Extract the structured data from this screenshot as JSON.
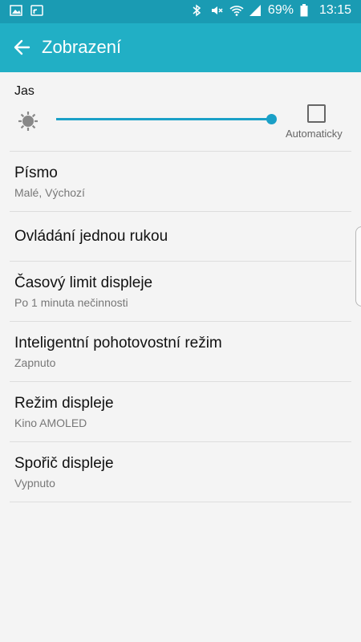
{
  "status_bar": {
    "battery_percent": "69%",
    "time": "13:15",
    "left_icons": [
      "gallery-icon",
      "cast-icon"
    ],
    "right_icons": [
      "bluetooth-icon",
      "mute-icon",
      "wifi-icon",
      "signal-icon",
      "battery-icon"
    ]
  },
  "appbar": {
    "title": "Zobrazení",
    "back_icon": "arrow-back-icon",
    "bg_color": "#21afc5"
  },
  "brightness": {
    "label": "Jas",
    "level": 1.0,
    "auto_label": "Automaticky",
    "auto_checked": false,
    "accent_color": "#1aa0c7"
  },
  "items": [
    {
      "title": "Písmo",
      "subtitle": "Malé, Výchozí"
    },
    {
      "title": "Ovládání jednou rukou",
      "subtitle": ""
    },
    {
      "title": "Časový limit displeje",
      "subtitle": "Po 1 minuta nečinnosti"
    },
    {
      "title": "Inteligentní pohotovostní režim",
      "subtitle": "Zapnuto"
    },
    {
      "title": "Režim displeje",
      "subtitle": "Kino AMOLED"
    },
    {
      "title": "Spořič displeje",
      "subtitle": "Vypnuto"
    }
  ]
}
